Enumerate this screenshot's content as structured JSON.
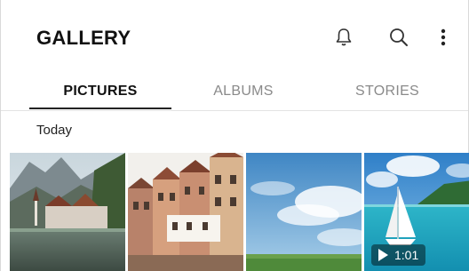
{
  "header": {
    "title": "GALLERY",
    "icons": [
      "bell-icon",
      "search-icon",
      "more-vert-icon"
    ]
  },
  "tabs": [
    {
      "label": "PICTURES",
      "active": true
    },
    {
      "label": "ALBUMS",
      "active": false
    },
    {
      "label": "STORIES",
      "active": false
    }
  ],
  "section": {
    "label": "Today"
  },
  "thumbnails": [
    {
      "subject": "lakeside-village",
      "type": "photo"
    },
    {
      "subject": "old-town-houses",
      "type": "photo"
    },
    {
      "subject": "sky-field",
      "type": "photo"
    },
    {
      "subject": "sailboat-sea",
      "type": "video",
      "duration": "1:01"
    }
  ],
  "colors": {
    "active_tab": "#111111",
    "inactive_tab": "#8a8a8a",
    "underline": "#222222"
  }
}
